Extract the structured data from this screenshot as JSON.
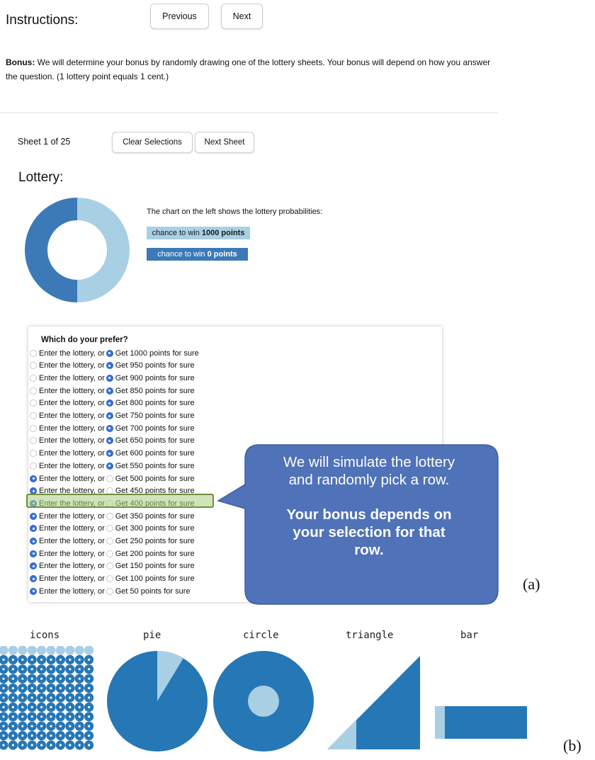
{
  "header": {
    "title": "Instructions:",
    "prev_label": "Previous",
    "next_label": "Next"
  },
  "bonus": {
    "label": "Bonus:",
    "text": " We will determine your bonus by randomly drawing one of the lottery sheets. Your bonus will depend on how you answer the question. (1 lottery point equals 1 cent.)"
  },
  "sheet": {
    "counter": "Sheet 1 of 25",
    "clear_label": "Clear Selections",
    "next_sheet_label": "Next Sheet"
  },
  "lottery": {
    "heading": "Lottery:",
    "description": "The chart on the left shows the lottery probabilities:",
    "win_prefix": "chance to win ",
    "win_amount": "1000 points",
    "lose_prefix": "chance to win ",
    "lose_amount": "0 points",
    "win_probability": 0.5,
    "colors": {
      "win": "#a9cfe4",
      "lose": "#3b7ab7"
    }
  },
  "question": {
    "prompt": "Which do your prefer?",
    "lottery_option": "Enter the lottery, or",
    "rows": [
      {
        "sure": "Get 1000 points for sure",
        "choice": "sure"
      },
      {
        "sure": "Get 950 points for sure",
        "choice": "sure"
      },
      {
        "sure": "Get 900 points for sure",
        "choice": "sure"
      },
      {
        "sure": "Get 850 points for sure",
        "choice": "sure"
      },
      {
        "sure": "Get 800 points for sure",
        "choice": "sure"
      },
      {
        "sure": "Get 750 points for sure",
        "choice": "sure"
      },
      {
        "sure": "Get 700 points for sure",
        "choice": "sure"
      },
      {
        "sure": "Get 650 points for sure",
        "choice": "sure"
      },
      {
        "sure": "Get 600 points for sure",
        "choice": "sure"
      },
      {
        "sure": "Get 550 points for sure",
        "choice": "sure"
      },
      {
        "sure": "Get 500 points for sure",
        "choice": "lottery"
      },
      {
        "sure": "Get 450 points for sure",
        "choice": "lottery"
      },
      {
        "sure": "Get 400 points for sure",
        "choice": "lottery"
      },
      {
        "sure": "Get 350 points for sure",
        "choice": "lottery"
      },
      {
        "sure": "Get 300 points for sure",
        "choice": "lottery"
      },
      {
        "sure": "Get 250 points for sure",
        "choice": "lottery"
      },
      {
        "sure": "Get 200 points for sure",
        "choice": "lottery"
      },
      {
        "sure": "Get 150 points for sure",
        "choice": "lottery"
      },
      {
        "sure": "Get 100 points for sure",
        "choice": "lottery"
      },
      {
        "sure": "Get 50 points for sure",
        "choice": "lottery"
      }
    ]
  },
  "callout": {
    "line1": "We will simulate the lottery",
    "line2": "and randomly pick a row.",
    "line3": "Your bonus depends on",
    "line4": "your selection for that",
    "line5": "row.",
    "color": "#4f72b8"
  },
  "panel_labels": {
    "a": "(a)",
    "b": "(b)"
  },
  "visualizations": {
    "icons": "icons",
    "pie": "pie",
    "circle": "circle",
    "triangle": "triangle",
    "bar": "bar",
    "dark_color": "#2677b6",
    "light_color": "#a9cfe4"
  }
}
